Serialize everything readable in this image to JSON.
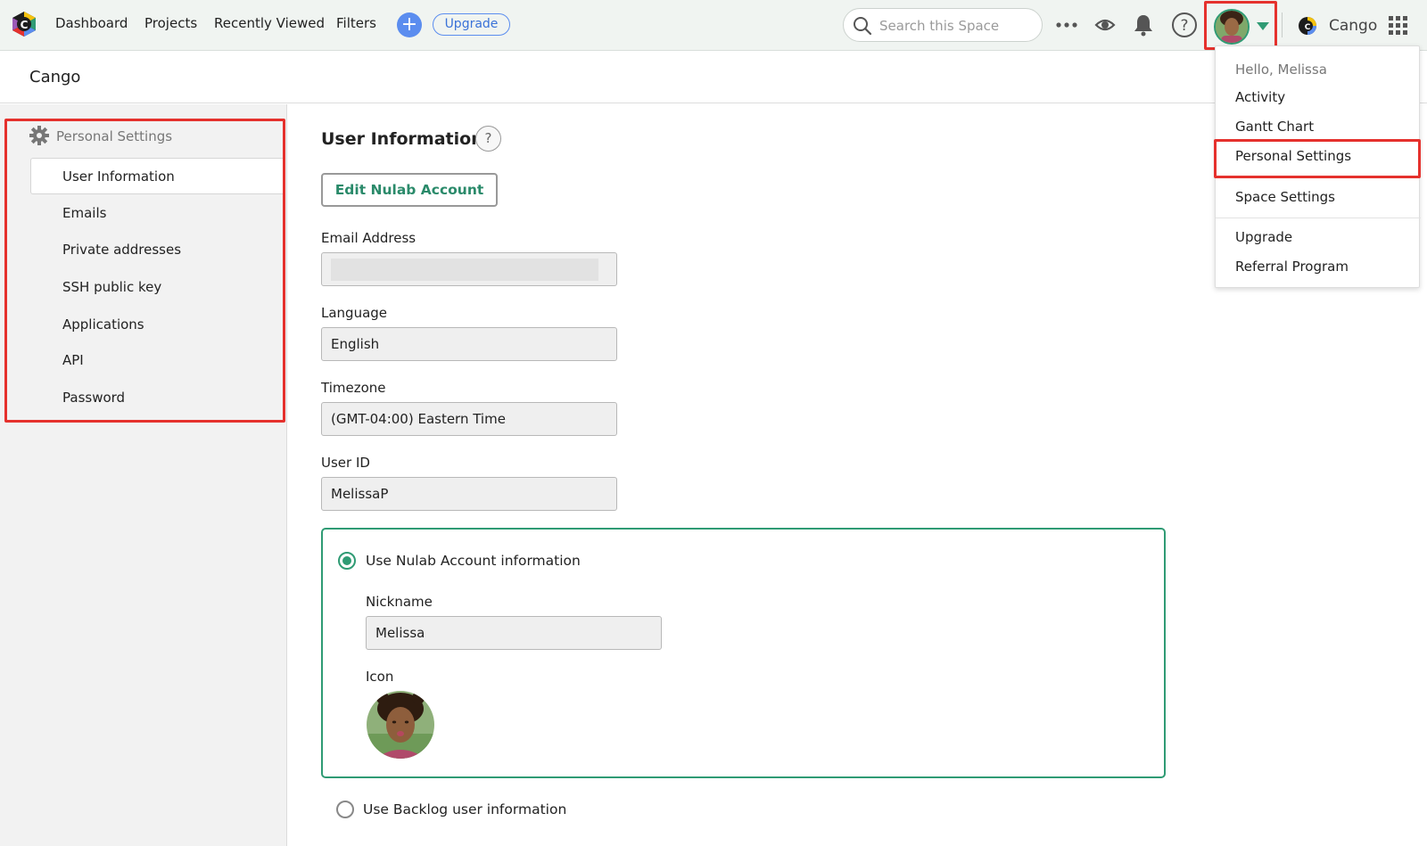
{
  "topbar": {
    "nav": [
      "Dashboard",
      "Projects",
      "Recently Viewed",
      "Filters"
    ],
    "add_label": "+",
    "upgrade_label": "Upgrade",
    "search_placeholder": "Search this Space",
    "space_name": "Cango"
  },
  "subheader": {
    "title": "Cango"
  },
  "sidebar": {
    "heading": "Personal Settings",
    "items": [
      "User Information",
      "Emails",
      "Private addresses",
      "SSH public key",
      "Applications",
      "API",
      "Password"
    ],
    "active": "User Information"
  },
  "main": {
    "title": "User Information",
    "help_label": "?",
    "edit_button": "Edit Nulab Account",
    "email_label": "Email Address",
    "email_value": "",
    "language_label": "Language",
    "language_value": "English",
    "timezone_label": "Timezone",
    "timezone_value": "(GMT-04:00) Eastern Time",
    "userid_label": "User ID",
    "userid_value": "MelissaP",
    "option_nulab": "Use Nulab Account information",
    "nickname_label": "Nickname",
    "nickname_value": "Melissa",
    "icon_label": "Icon",
    "option_backlog": "Use Backlog user information"
  },
  "dropdown": {
    "greeting": "Hello, Melissa",
    "items": [
      "Activity",
      "Gantt Chart",
      "Personal Settings",
      "Space Settings",
      "Upgrade",
      "Referral Program"
    ]
  },
  "colors": {
    "accent": "#2f9b74",
    "highlight": "#e5312d",
    "link_blue": "#5b8def"
  }
}
